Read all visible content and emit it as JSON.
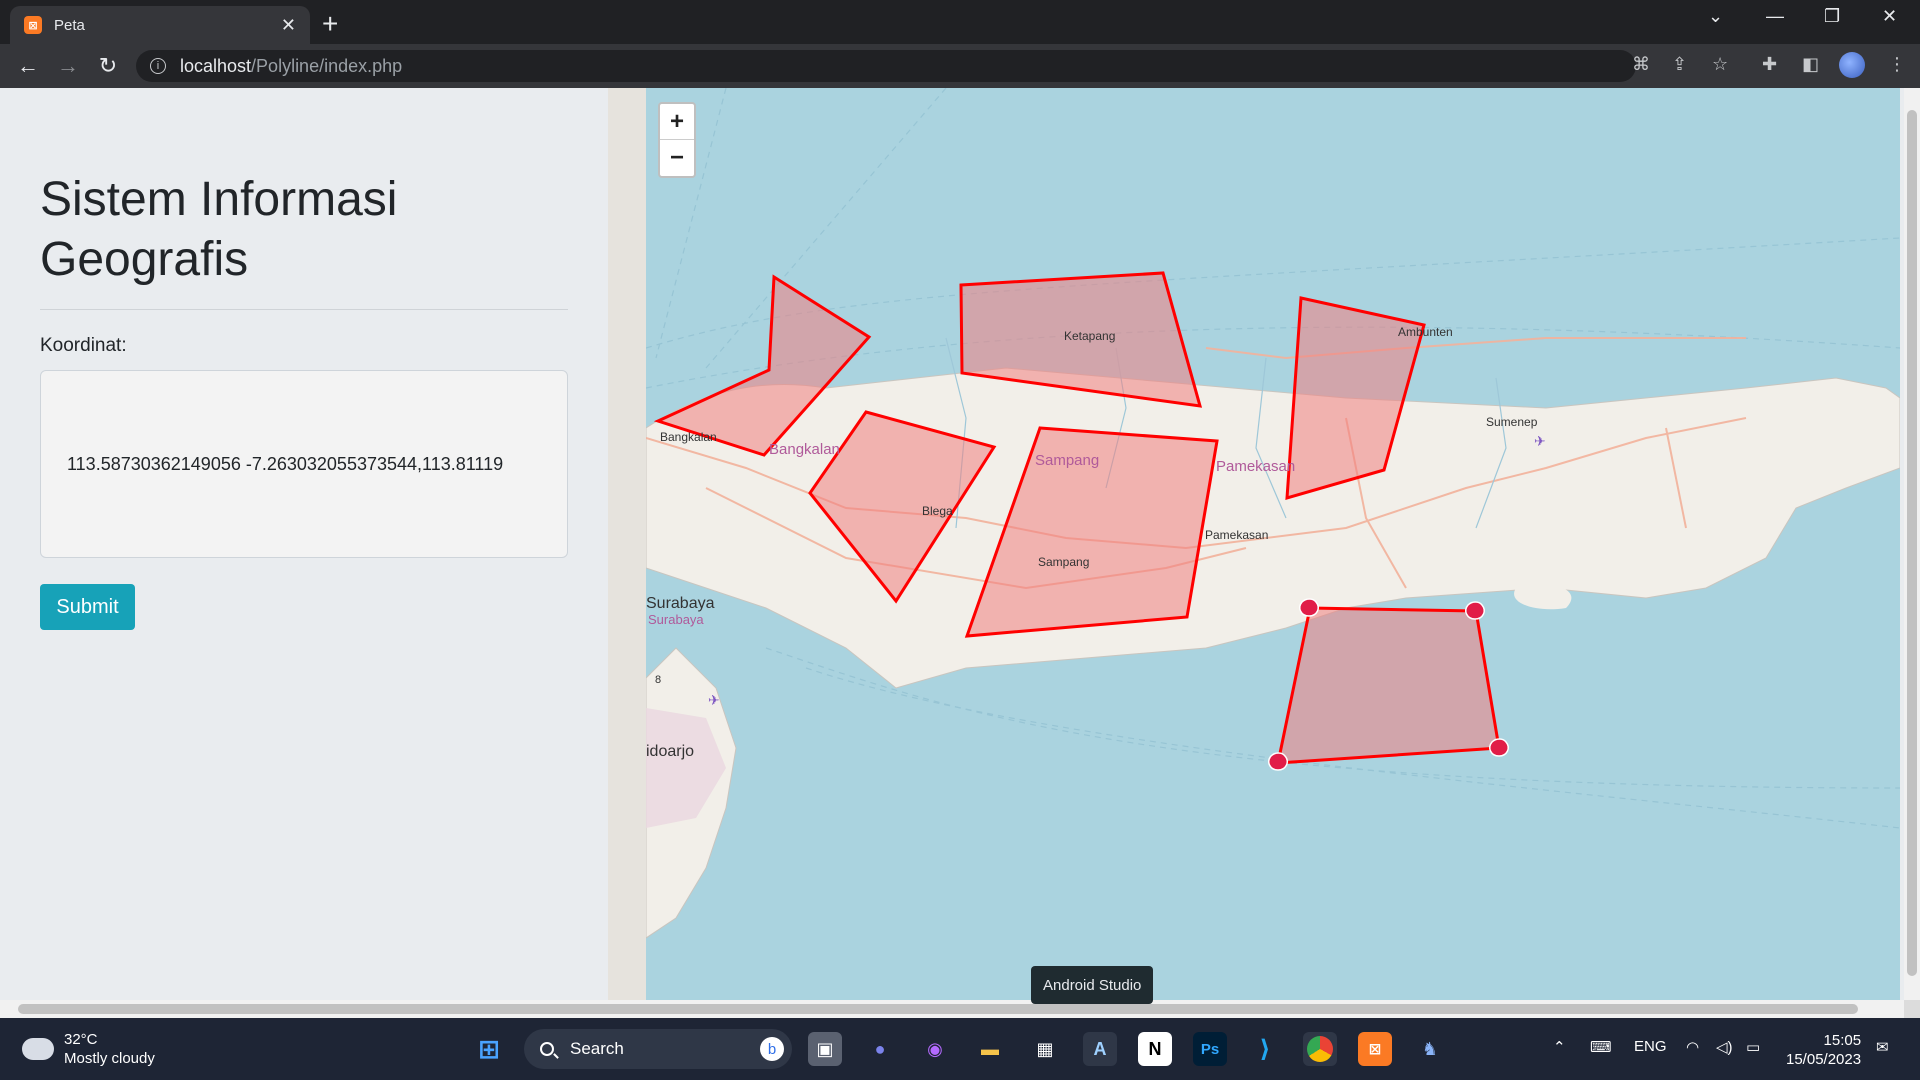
{
  "browser": {
    "tab_title": "Peta",
    "tab_favicon": "xampp-icon",
    "url_host": "localhost",
    "url_path": "/Polyline/index.php"
  },
  "page": {
    "title": "Sistem Informasi Geografis",
    "coord_label": "Koordinat:",
    "coord_value": "113.58730362149056 -7.263032055373544,113.81119",
    "submit_label": "Submit"
  },
  "map": {
    "zoom_in": "+",
    "zoom_out": "−",
    "places": [
      {
        "name": "Ketapang"
      },
      {
        "name": "Ambunten"
      },
      {
        "name": "Sumenep"
      },
      {
        "name": "Bangkalan"
      },
      {
        "name": "Bangkalan"
      },
      {
        "name": "Blega"
      },
      {
        "name": "Sampang"
      },
      {
        "name": "Sampang"
      },
      {
        "name": "Pamekasan"
      },
      {
        "name": "Pamekasan"
      },
      {
        "name": "Surabaya"
      },
      {
        "name": "Surabaya"
      },
      {
        "name": "idoarjo"
      },
      {
        "name": "8"
      }
    ],
    "polygon_stroke": "#ff0000",
    "polygon_fill": "#f08080",
    "water_color": "#aad3df",
    "land_color": "#f2efe9"
  },
  "tooltip": "Android Studio",
  "taskbar": {
    "weather_temp": "32°C",
    "weather_desc": "Mostly cloudy",
    "search_label": "Search",
    "lang": "ENG",
    "time": "15:05",
    "date": "15/05/2023",
    "apps": [
      "start-icon",
      "bing-icon",
      "task-view-icon",
      "meet-icon",
      "github-icon",
      "file-explorer-icon",
      "store-icon",
      "android-studio-icon",
      "notion-icon",
      "photoshop-icon",
      "vscode-icon",
      "chrome-icon",
      "xampp-icon",
      "postgres-icon"
    ]
  }
}
